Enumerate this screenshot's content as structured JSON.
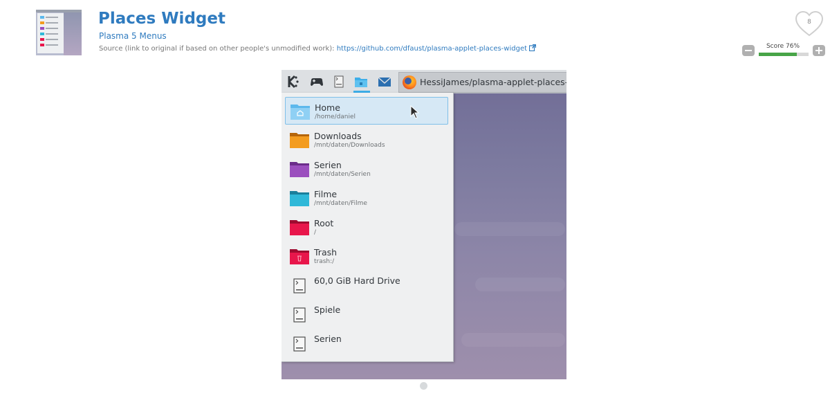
{
  "product": {
    "title": "Places Widget",
    "category": "Plasma 5 Menus",
    "source_label": "Source (link to original if based on other people's unmodified work): ",
    "source_url": "https://github.com/dfaust/plasma-applet-places-widget"
  },
  "rating": {
    "likes": "8",
    "score_label": "Score 76%",
    "score_fraction": 0.76
  },
  "screenshot": {
    "taskbar": {
      "icons": [
        "kde-icon",
        "gamepad-icon",
        "drive-icon",
        "places-folder-icon",
        "mail-icon"
      ],
      "active_window": "HessiJames/plasma-applet-places-w"
    },
    "places": [
      {
        "name": "Home",
        "path": "/home/daniel",
        "color": "#5cb8ec",
        "icon": "home-folder-icon",
        "selected": true
      },
      {
        "name": "Downloads",
        "path": "/mnt/daten/Downloads",
        "color": "#f39c1f",
        "icon": "folder-icon"
      },
      {
        "name": "Serien",
        "path": "/mnt/daten/Serien",
        "color": "#9b4fbe",
        "icon": "folder-icon"
      },
      {
        "name": "Filme",
        "path": "/mnt/daten/Filme",
        "color": "#2fb8d8",
        "icon": "folder-icon"
      },
      {
        "name": "Root",
        "path": "/",
        "color": "#e8164b",
        "icon": "folder-icon"
      },
      {
        "name": "Trash",
        "path": "trash:/",
        "color": "#e8164b",
        "icon": "trash-folder-icon"
      }
    ],
    "drives": [
      {
        "name": "60,0 GiB Hard Drive"
      },
      {
        "name": "Spiele"
      },
      {
        "name": "Serien"
      }
    ]
  },
  "colors": {
    "accent": "#2f7bbf",
    "score_fill": "#47a447",
    "plasma_blue": "#3daee9"
  }
}
